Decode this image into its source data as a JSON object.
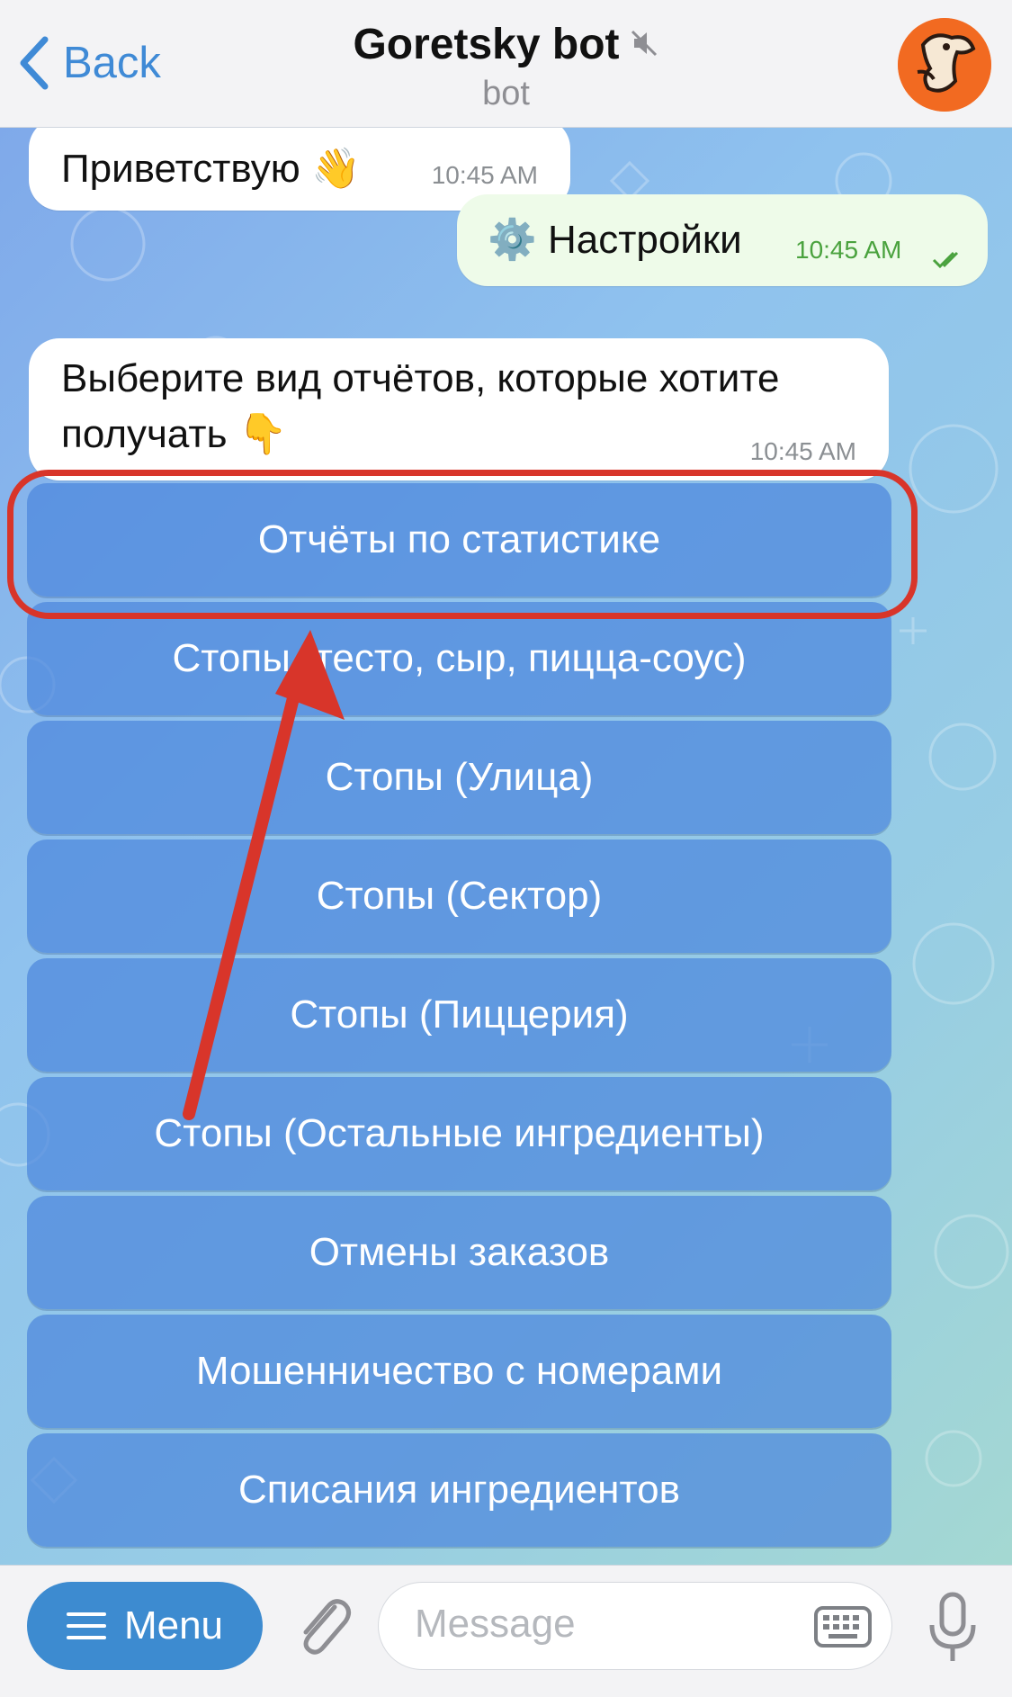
{
  "header": {
    "back_label": "Back",
    "title": "Goretsky bot",
    "subtitle": "bot"
  },
  "messages": [
    {
      "text": "Приветствую 👋",
      "time": "10:45 AM",
      "direction": "in"
    },
    {
      "text": "⚙️ Настройки",
      "time": "10:45 AM",
      "direction": "out"
    },
    {
      "text_line1": "Выберите вид отчётов, которые хотите",
      "text_line2": "получать 👇",
      "time": "10:45 AM",
      "direction": "in"
    }
  ],
  "keyboard": [
    "Отчёты по статистике",
    "Стопы (тесто, сыр, пицца-соус)",
    "Стопы (Улица)",
    "Стопы (Сектор)",
    "Стопы (Пиццерия)",
    "Стопы (Остальные ингредиенты)",
    "Отмены заказов",
    "Мошенничество с номерами",
    "Списания ингредиентов"
  ],
  "input": {
    "menu_label": "Menu",
    "placeholder": "Message"
  },
  "colors": {
    "accent": "#3d8bd0",
    "annotation": "#d8352a",
    "avatar_bg": "#f26a21"
  }
}
